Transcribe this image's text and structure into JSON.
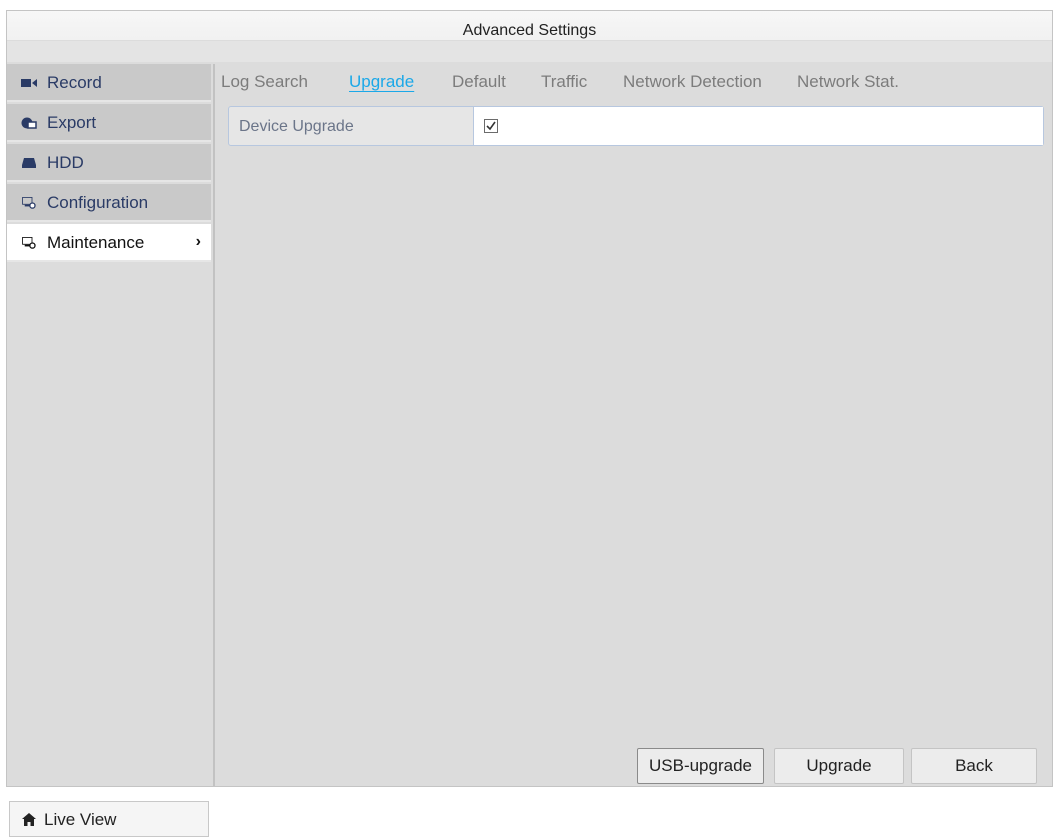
{
  "window": {
    "title": "Advanced Settings"
  },
  "sidebar": {
    "items": [
      {
        "label": "Record",
        "icon": "record-icon"
      },
      {
        "label": "Export",
        "icon": "export-icon"
      },
      {
        "label": "HDD",
        "icon": "hdd-icon"
      },
      {
        "label": "Configuration",
        "icon": "configuration-icon"
      },
      {
        "label": "Maintenance",
        "icon": "maintenance-icon",
        "active": true
      }
    ],
    "live_view": {
      "label": "Live View",
      "icon": "home-icon"
    }
  },
  "tabs": [
    {
      "label": "Log Search"
    },
    {
      "label": "Upgrade",
      "active": true
    },
    {
      "label": "Default"
    },
    {
      "label": "Traffic"
    },
    {
      "label": "Network Detection"
    },
    {
      "label": "Network Stat."
    }
  ],
  "form": {
    "device_upgrade": {
      "label": "Device Upgrade",
      "checked": true
    }
  },
  "buttons": {
    "usb_upgrade": "USB-upgrade",
    "upgrade": "Upgrade",
    "back": "Back"
  },
  "colors": {
    "accent": "#1ba8e8",
    "active_item_bg": "#ffffff",
    "sidebar_item_bg": "#c9c9c9"
  }
}
